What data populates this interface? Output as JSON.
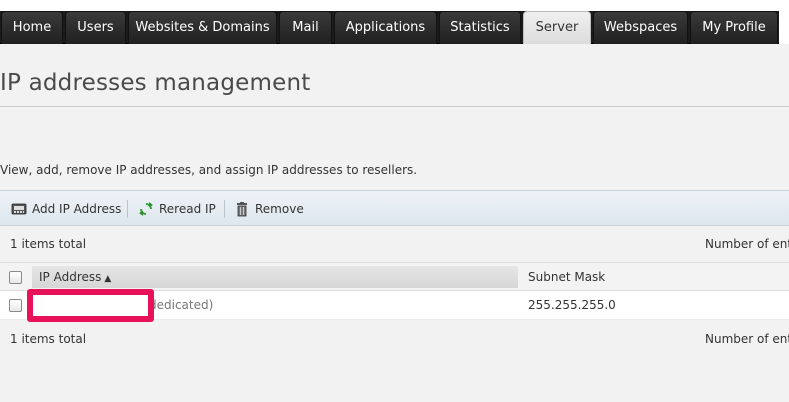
{
  "tabs": [
    {
      "label": "Home",
      "active": false
    },
    {
      "label": "Users",
      "active": false
    },
    {
      "label": "Websites & Domains",
      "active": false
    },
    {
      "label": "Mail",
      "active": false
    },
    {
      "label": "Applications",
      "active": false
    },
    {
      "label": "Statistics",
      "active": false
    },
    {
      "label": "Server",
      "active": true
    },
    {
      "label": "Webspaces",
      "active": false
    },
    {
      "label": "My Profile",
      "active": false
    }
  ],
  "page": {
    "title": "IP addresses management",
    "description": "View, add, remove IP addresses, and assign IP addresses to resellers."
  },
  "toolbar": {
    "add_label": "Add IP Address",
    "reread_label": "Reread IP",
    "remove_label": "Remove"
  },
  "list": {
    "items_total_top": "1 items total",
    "items_total_bottom": "1 items total",
    "entries_label": "Number of ent",
    "columns": {
      "ip": "IP Address",
      "subnet": "Subnet Mask"
    },
    "rows": [
      {
        "ip_suffix": "dedicated)",
        "subnet": "255.255.255.0"
      }
    ]
  },
  "colors": {
    "redaction_border": "#e8125a",
    "toolbar_bg": "#e4ecf2"
  }
}
